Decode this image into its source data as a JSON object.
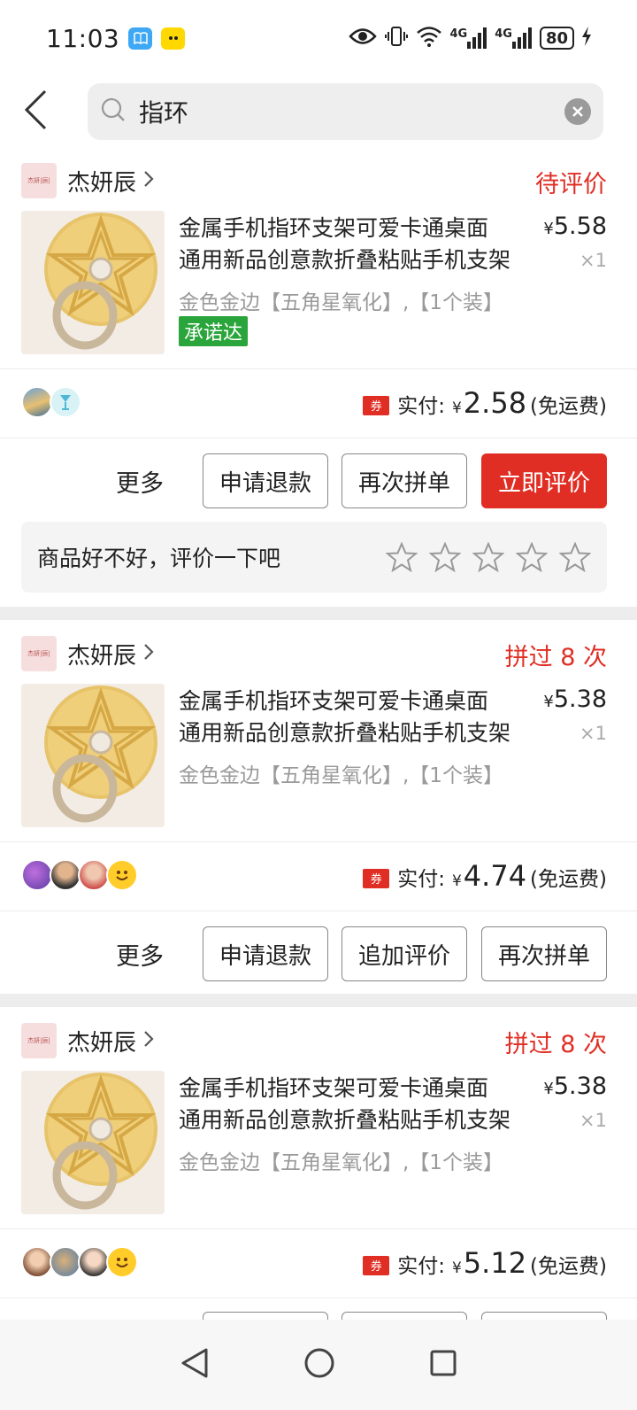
{
  "status_bar": {
    "time": "11:03",
    "network_1": "4G",
    "network_2": "4G",
    "battery": "80"
  },
  "search": {
    "query": "指环"
  },
  "orders": [
    {
      "shop_name": "杰妍辰",
      "shop_logo_text": "杰妍|辰|",
      "status": "待评价",
      "title_line1": "金属手机指环支架可爱卡通桌面",
      "title_line2": "通用新品创意款折叠粘贴手机支架",
      "sku": "金色金边【五角星氧化】,【1个装】",
      "price_symbol": "¥",
      "price": "5.58",
      "quantity": "×1",
      "promise_tag": "承诺达",
      "coupon": "券",
      "paid_label": "实付:",
      "paid_symbol": "¥",
      "paid_amount": "2.58",
      "shipping": "(免运费)",
      "actions": {
        "more": "更多",
        "btn1": "申请退款",
        "btn2": "再次拼单",
        "btn3": "立即评价"
      },
      "rating_prompt": "商品好不好，评价一下吧"
    },
    {
      "shop_name": "杰妍辰",
      "shop_logo_text": "杰妍|辰|",
      "status": "拼过 8 次",
      "title_line1": "金属手机指环支架可爱卡通桌面",
      "title_line2": "通用新品创意款折叠粘贴手机支架",
      "sku": "金色金边【五角星氧化】,【1个装】",
      "price_symbol": "¥",
      "price": "5.38",
      "quantity": "×1",
      "coupon": "券",
      "paid_label": "实付:",
      "paid_symbol": "¥",
      "paid_amount": "4.74",
      "shipping": "(免运费)",
      "actions": {
        "more": "更多",
        "btn1": "申请退款",
        "btn2": "追加评价",
        "btn3": "再次拼单"
      }
    },
    {
      "shop_name": "杰妍辰",
      "shop_logo_text": "杰妍|辰|",
      "status": "拼过 8 次",
      "title_line1": "金属手机指环支架可爱卡通桌面",
      "title_line2": "通用新品创意款折叠粘贴手机支架",
      "sku": "金色金边【五角星氧化】,【1个装】",
      "price_symbol": "¥",
      "price": "5.38",
      "quantity": "×1",
      "coupon": "券",
      "paid_label": "实付:",
      "paid_symbol": "¥",
      "paid_amount": "5.12",
      "shipping": "(免运费)"
    }
  ],
  "colors": {
    "accent": "#e02e24",
    "promise": "#2aa53b"
  }
}
